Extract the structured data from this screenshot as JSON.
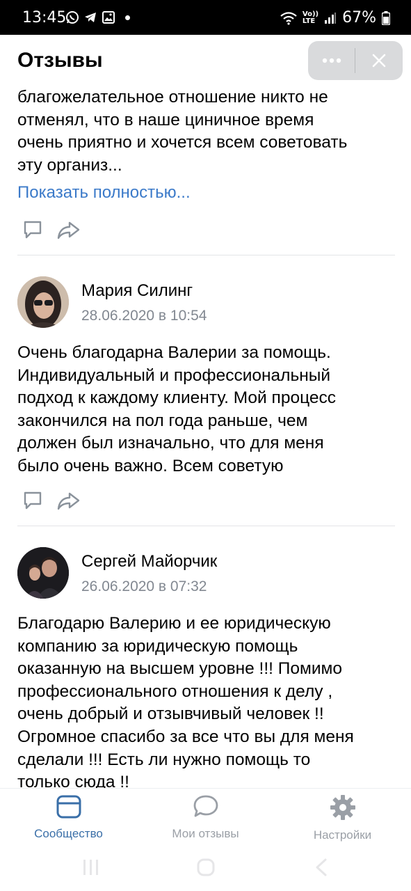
{
  "status_bar": {
    "time": "13:45",
    "lte_top": "Vo))",
    "lte_bottom": "LTE",
    "battery": "67%"
  },
  "header": {
    "title": "Отзывы"
  },
  "reviews": [
    {
      "text_lines": [
        "благожелательное отношение никто не",
        "отменял, что в наше циничное время",
        "очень приятно и хочется всем советовать",
        "эту организ..."
      ],
      "show_more": "Показать полностью..."
    },
    {
      "author": "Мария Силинг",
      "date": "28.06.2020 в 10:54",
      "text_lines": [
        "Очень благодарна Валерии за помощь.",
        "Индивидуальный и профессиональный",
        "подход к каждому клиенту. Мой процесс",
        "закончился на пол года раньше, чем",
        "должен был изначально, что для меня",
        "было очень важно. Всем советую"
      ]
    },
    {
      "author": "Сергей Майорчик",
      "date": "26.06.2020 в 07:32",
      "text_lines": [
        "Благодарю Валерию и ее юридическую",
        "компанию за юридическую помощь",
        "оказанную на высшем уровне !!! Помимо",
        "профессионального отношения к делу ,",
        "очень добрый и отзывчивый человек !!",
        "Огромное спасибо за все что вы для меня",
        "сделали !!! Есть ли нужно помощь то",
        "только сюда !!"
      ]
    }
  ],
  "bottom_nav": [
    {
      "label": "Сообщество",
      "icon": "community-icon",
      "active": true
    },
    {
      "label": "Мои отзывы",
      "icon": "speech-bubble-icon",
      "active": false
    },
    {
      "label": "Настройки",
      "icon": "gear-icon",
      "active": false
    }
  ],
  "colors": {
    "accent": "#3a6fa8",
    "link": "#3b7ac9",
    "muted": "#828891"
  }
}
